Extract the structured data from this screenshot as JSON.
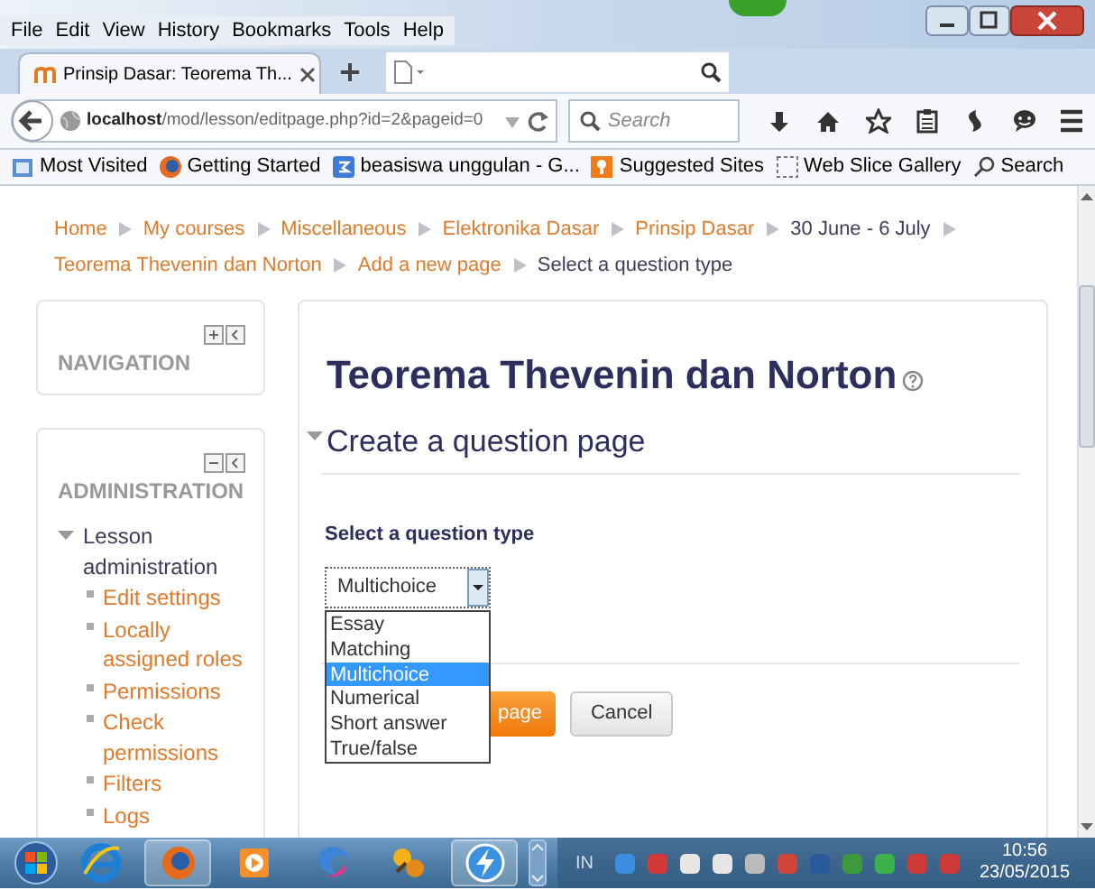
{
  "menu_bar": [
    "File",
    "Edit",
    "View",
    "History",
    "Bookmarks",
    "Tools",
    "Help"
  ],
  "tabs": [
    {
      "title": "Prinsip Dasar: Teorema Th...",
      "selected": true
    }
  ],
  "address_bar": {
    "host": "localhost",
    "path": "/mod/lesson/editpage.php?id=2&pageid=0"
  },
  "search": {
    "placeholder": "Search"
  },
  "bookmarks": [
    {
      "label": "Most Visited",
      "kind": "folder"
    },
    {
      "label": "Getting Started",
      "kind": "fox"
    },
    {
      "label": "beasiswa unggulan - G...",
      "kind": "site"
    },
    {
      "label": "Suggested Sites",
      "kind": "bulb"
    },
    {
      "label": "Web Slice Gallery",
      "kind": "slice"
    },
    {
      "label": "Search",
      "kind": "search"
    }
  ],
  "breadcrumb": [
    {
      "label": "Home",
      "link": true
    },
    {
      "label": "My courses",
      "link": true
    },
    {
      "label": "Miscellaneous",
      "link": true
    },
    {
      "label": "Elektronika Dasar",
      "link": true
    },
    {
      "label": "Prinsip Dasar",
      "link": true
    },
    {
      "label": "30 June - 6 July",
      "link": false
    },
    {
      "label": "Teorema Thevenin dan Norton",
      "link": true
    },
    {
      "label": "Add a new page",
      "link": true
    },
    {
      "label": "Select a question type",
      "link": false
    }
  ],
  "navigation_block": {
    "title": "NAVIGATION"
  },
  "administration_block": {
    "title": "ADMINISTRATION",
    "tree": [
      {
        "label": "Lesson administration",
        "expanded": true,
        "children": [
          {
            "label": "Edit settings"
          },
          {
            "label": "Locally assigned roles"
          },
          {
            "label": "Permissions"
          },
          {
            "label": "Check permissions"
          },
          {
            "label": "Filters"
          },
          {
            "label": "Logs"
          }
        ]
      }
    ]
  },
  "page_title": "Teorema Thevenin dan Norton",
  "section": {
    "title": "Create a question page",
    "expanded": true
  },
  "question_type": {
    "label": "Select a question type",
    "value": "Multichoice",
    "expanded": true,
    "options": [
      {
        "label": "Essay",
        "selected": false
      },
      {
        "label": "Matching",
        "selected": false
      },
      {
        "label": "Multichoice",
        "selected": true
      },
      {
        "label": "Numerical",
        "selected": false
      },
      {
        "label": "Short answer",
        "selected": false
      },
      {
        "label": "True/false",
        "selected": false
      }
    ]
  },
  "buttons": [
    {
      "label": "page",
      "kind": "primary"
    },
    {
      "label": "Cancel",
      "kind": "secondary"
    }
  ],
  "taskbar": {
    "language": "IN",
    "time": "10:56",
    "date": "23/05/2015"
  }
}
